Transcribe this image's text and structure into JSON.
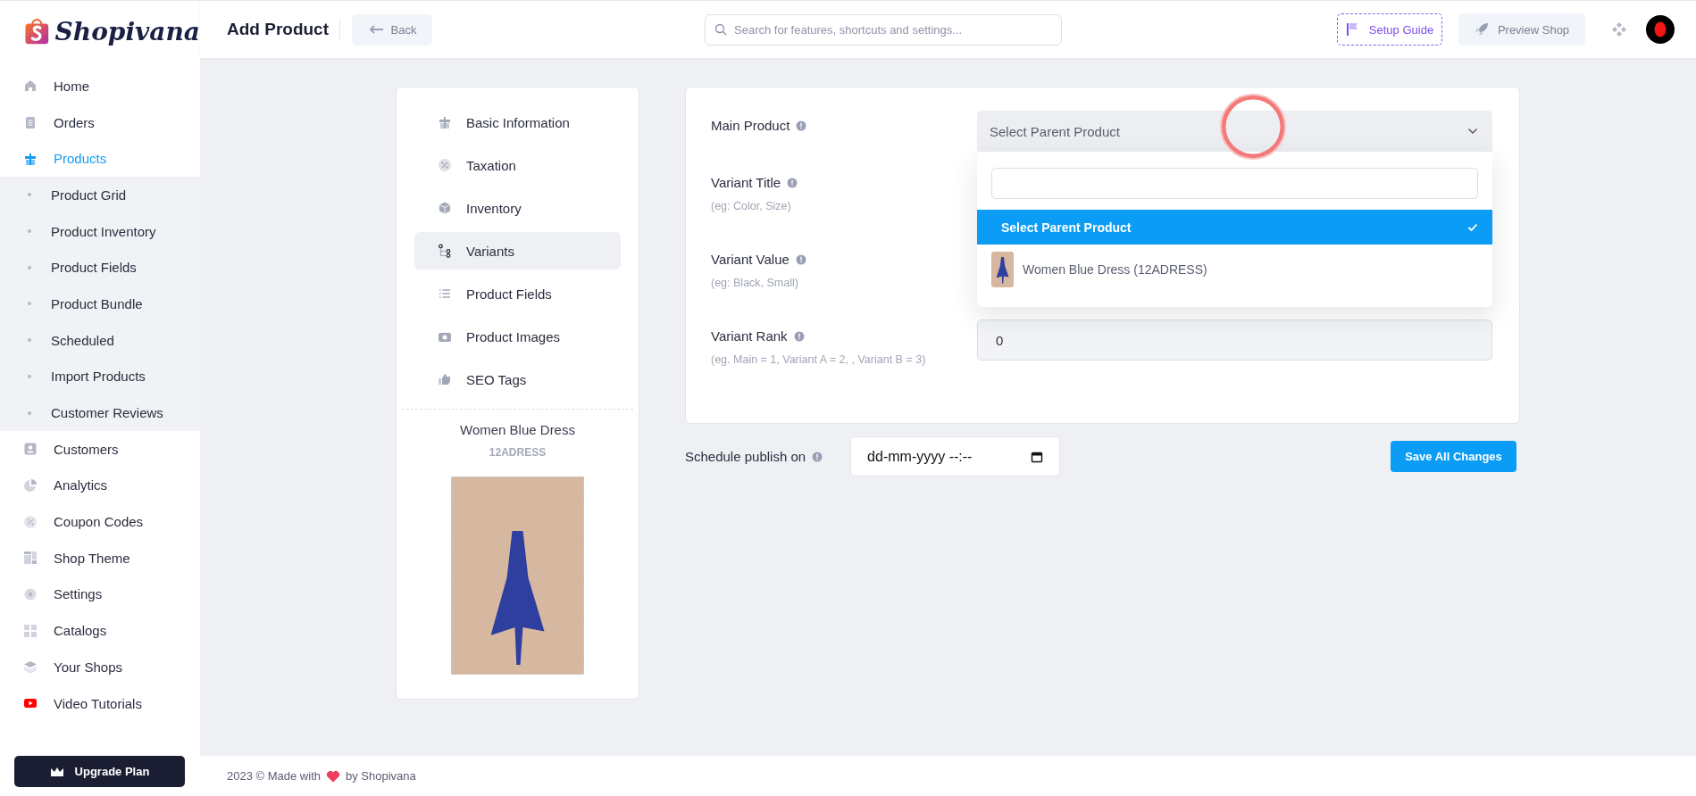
{
  "logo": {
    "text": "Shopivana"
  },
  "sidebar": {
    "items": [
      {
        "label": "Home",
        "selected": false
      },
      {
        "label": "Orders",
        "selected": false
      },
      {
        "label": "Products",
        "selected": true,
        "expanded": true,
        "children": [
          {
            "label": "Product Grid",
            "selected": false
          },
          {
            "label": "Product Inventory",
            "selected": false
          },
          {
            "label": "Product Fields",
            "selected": false
          },
          {
            "label": "Product Bundle",
            "selected": false
          },
          {
            "label": "Scheduled",
            "selected": false
          },
          {
            "label": "Import Products",
            "selected": false
          },
          {
            "label": "Customer Reviews",
            "selected": false
          }
        ]
      },
      {
        "label": "Customers",
        "selected": false
      },
      {
        "label": "Analytics",
        "selected": false
      },
      {
        "label": "Coupon Codes",
        "selected": false
      },
      {
        "label": "Shop Theme",
        "selected": false
      },
      {
        "label": "Settings",
        "selected": false
      },
      {
        "label": "Catalogs",
        "selected": false
      },
      {
        "label": "Your Shops",
        "selected": false
      },
      {
        "label": "Video Tutorials",
        "selected": false
      }
    ],
    "upgrade_button": "Upgrade Plan"
  },
  "header": {
    "title": "Add Product",
    "back_button": "Back",
    "search": {
      "placeholder": "Search for features, shortcuts and settings..."
    },
    "setup_guide": "Setup Guide",
    "preview_shop": "Preview Shop"
  },
  "steps": [
    {
      "label": "Basic Information",
      "selected": false
    },
    {
      "label": "Taxation",
      "selected": false
    },
    {
      "label": "Inventory",
      "selected": false
    },
    {
      "label": "Variants",
      "selected": true
    },
    {
      "label": "Product Fields",
      "selected": false
    },
    {
      "label": "Product Images",
      "selected": false
    },
    {
      "label": "SEO Tags",
      "selected": false
    }
  ],
  "product": {
    "name": "Women Blue Dress",
    "sku": "12ADRESS"
  },
  "form": {
    "fields": [
      {
        "kind": "select",
        "label": "Main Product",
        "value": "Select Parent Product",
        "expanded": true,
        "options": [
          {
            "label": "Select Parent Product",
            "selected": true
          },
          {
            "label": "Women Blue Dress (12ADRESS)",
            "selected": false
          }
        ]
      },
      {
        "kind": "covered",
        "label": "Variant Title",
        "hint": "(eg: Color, Size)"
      },
      {
        "kind": "covered",
        "label": "Variant Value",
        "hint": "(eg: Black, Small)"
      },
      {
        "kind": "input",
        "label": "Variant Rank",
        "hint": "(eg. Main = 1, Variant A = 2, , Variant B = 3)",
        "value": "0"
      }
    ]
  },
  "schedule": {
    "label": "Schedule publish on",
    "placeholder": "dd-mm-yyyy --:--"
  },
  "save_button": "Save All Changes",
  "footer": {
    "prefix": "2023 ©  Made with",
    "suffix": "by Shopivana"
  }
}
